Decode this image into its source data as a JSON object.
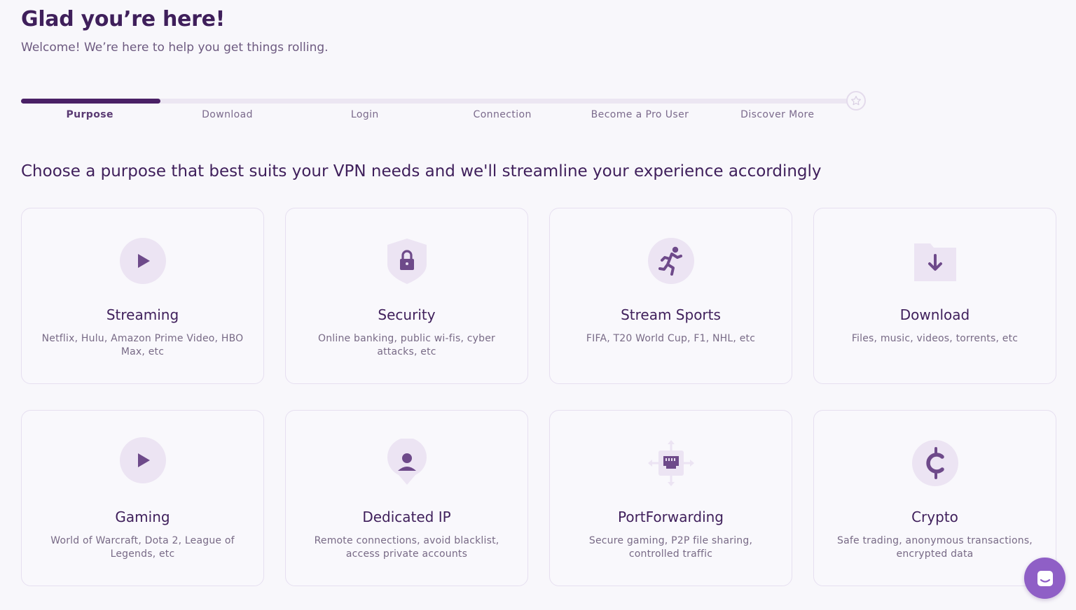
{
  "header": {
    "title": "Glad you’re here!",
    "subtitle": "Welcome! We’re here to help you get things rolling."
  },
  "stepper": {
    "progress": 0.1667,
    "steps": [
      {
        "label": "Purpose",
        "active": true
      },
      {
        "label": "Download",
        "active": false
      },
      {
        "label": "Login",
        "active": false
      },
      {
        "label": "Connection",
        "active": false
      },
      {
        "label": "Become a Pro User",
        "active": false
      },
      {
        "label": "Discover More",
        "active": false
      }
    ],
    "end_icon": "star-icon"
  },
  "heading": "Choose a purpose that best suits your VPN needs and we'll streamline your experience accordingly",
  "cards": [
    {
      "title": "Streaming",
      "desc": "Netflix, Hulu, Amazon Prime Video, HBO Max, etc",
      "icon": "play-icon"
    },
    {
      "title": "Security",
      "desc": "Online banking, public wi-fis, cyber attacks, etc",
      "icon": "shield-lock-icon"
    },
    {
      "title": "Stream Sports",
      "desc": "FIFA, T20 World Cup, F1, NHL, etc",
      "icon": "runner-icon"
    },
    {
      "title": "Download",
      "desc": "Files, music, videos, torrents, etc",
      "icon": "folder-download-icon"
    },
    {
      "title": "Gaming",
      "desc": "World of Warcraft, Dota 2, League of Legends, etc",
      "icon": "play-icon"
    },
    {
      "title": "Dedicated IP",
      "desc": "Remote connections, avoid blacklist, access private accounts",
      "icon": "user-pin-icon"
    },
    {
      "title": "PortForwarding",
      "desc": "Secure gaming, P2P file sharing, controlled traffic",
      "icon": "port-icon"
    },
    {
      "title": "Crypto",
      "desc": "Safe trading, anonymous transactions, encrypted data",
      "icon": "crypto-icon"
    }
  ],
  "chat": {
    "icon": "chat-icon"
  },
  "colors": {
    "accent": "#4a2066",
    "icon_bg": "#ece4f3",
    "icon_fg": "#6e4a8a",
    "chat": "#8f5fc6"
  }
}
